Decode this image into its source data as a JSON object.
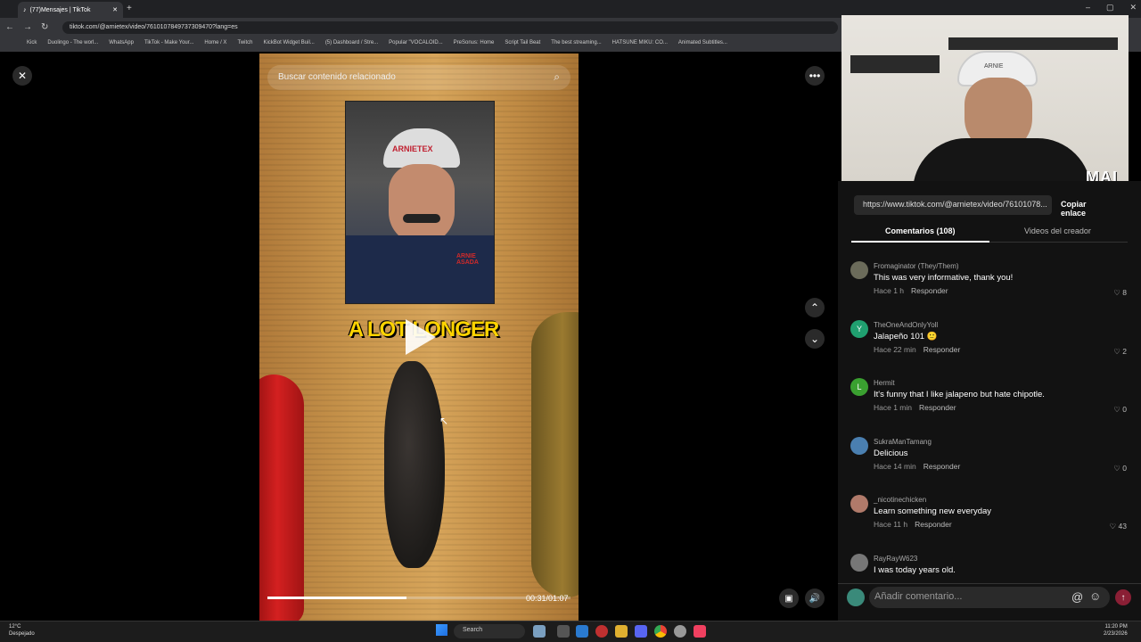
{
  "browser": {
    "tab_title": "(77)Mensajes | TikTok",
    "url": "tiktok.com/@arnietex/video/7610107849737309470?lang=es",
    "bookmarks": [
      "Kick",
      "Duolingo - The worl...",
      "WhatsApp",
      "TikTok - Make Your...",
      "Home / X",
      "Twitch",
      "KickBot Widget Buil...",
      "(5) Dashboard / Stre...",
      "Popular \"VOCALOID...",
      "PreSonus: Home",
      "Script Tail Beat",
      "The best streaming...",
      "HATSUNE MIKU: CO...",
      "Animated Subtitles..."
    ]
  },
  "video": {
    "search_placeholder": "Buscar contenido relacionado",
    "logo_text": "ARNIETEX",
    "shirt_text": "ARNIE ASADA",
    "caption": "A LOT LONGER",
    "timecode": "00:31/01:07",
    "progress": 0.46
  },
  "webcam": {
    "label": "MAI",
    "cap_text": "ARNIE"
  },
  "panel": {
    "link": "https://www.tiktok.com/@arnietex/video/76101078...",
    "copy_label": "Copiar enlace",
    "tab_comments": "Comentarios (108)",
    "tab_creator": "Videos del creador",
    "reply_label": "Responder",
    "comment_placeholder": "Añadir comentario...",
    "comments": [
      {
        "user": "Fromaginator (They/Them)",
        "text": "This was very informative, thank you!",
        "time": "Hace 1 h",
        "likes": "8",
        "avatar": "",
        "color": "#6b6b5a"
      },
      {
        "user": "TheOneAndOnlyYoll",
        "text": "Jalapeño 101 🙂",
        "time": "Hace 22 min",
        "likes": "2",
        "avatar": "Y",
        "color": "#20a070"
      },
      {
        "user": "Hermit",
        "text": "It's funny that I like jalapeno but hate chipotle.",
        "time": "Hace 1 min",
        "likes": "0",
        "avatar": "L",
        "color": "#3aa030"
      },
      {
        "user": "SukraManTamang",
        "text": "Delicious",
        "time": "Hace 14 min",
        "likes": "0",
        "avatar": "",
        "color": "#4a7fb0"
      },
      {
        "user": "_nicotinechicken",
        "text": "Learn something new everyday",
        "time": "Hace 11 h",
        "likes": "43",
        "avatar": "",
        "color": "#b07a6a"
      },
      {
        "user": "RayRayW623",
        "text": "I was today years old.",
        "time": "",
        "likes": "",
        "avatar": "",
        "color": "#777"
      }
    ]
  },
  "taskbar": {
    "weather_temp": "12°C",
    "weather_desc": "Despejado",
    "search_label": "Search",
    "time": "11:20 PM",
    "date": "2/23/2026"
  }
}
